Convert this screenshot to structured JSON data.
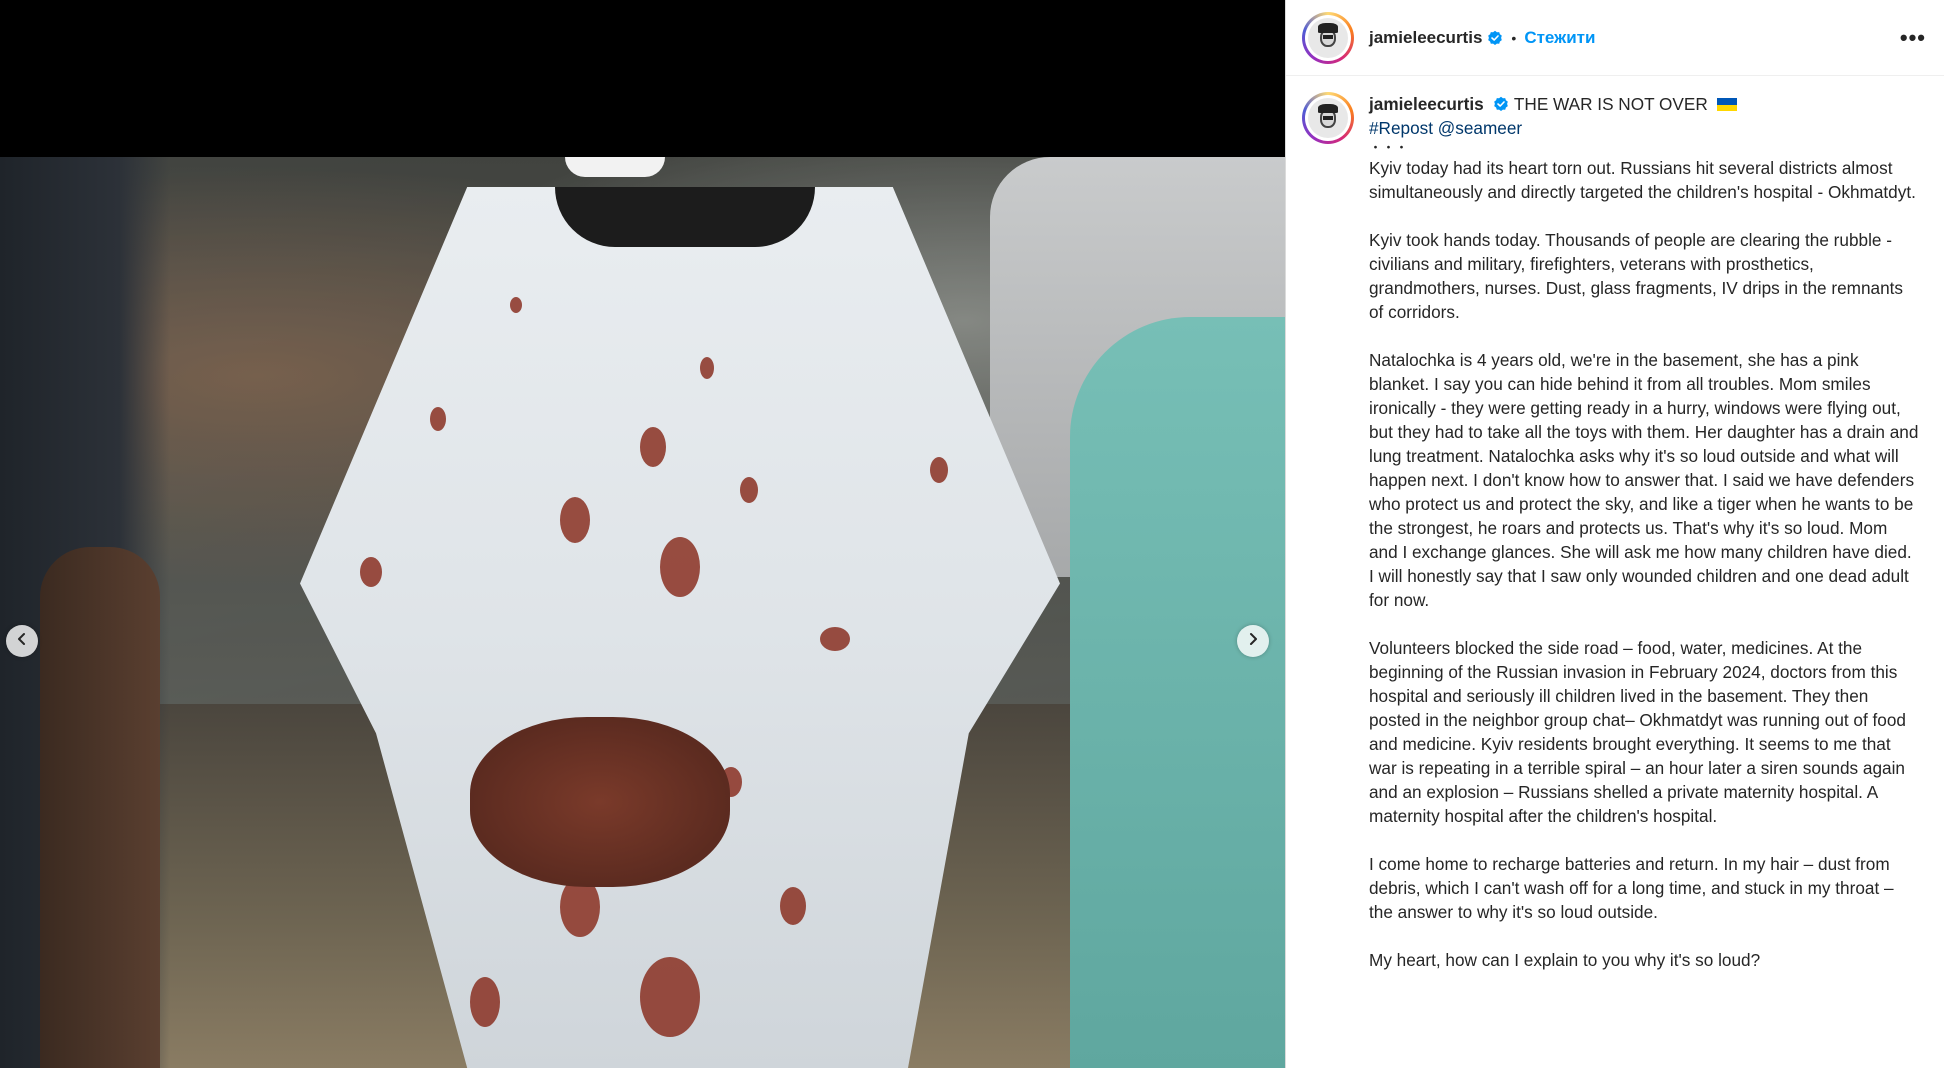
{
  "colors": {
    "accent": "#0095f6",
    "hashtag": "#00376b",
    "verified": "#0095f6"
  },
  "icons": {
    "prev": "chevron-left-icon",
    "next": "chevron-right-icon",
    "more": "more-horizontal-icon",
    "verified": "verified-badge-icon",
    "flag": "ukraine-flag-icon"
  },
  "header": {
    "username": "jamieleecurtis",
    "separator": "•",
    "follow_label": "Стежити",
    "more_label": "•••"
  },
  "caption": {
    "username": "jamieleecurtis",
    "title": "THE WAR IS NOT OVER",
    "repost": "#Repost @seameer",
    "dots": "・・・",
    "paragraphs": [
      "Kyiv today had its heart torn out. Russians hit several districts almost simultaneously and directly targeted the children's hospital - Okhmatdyt.",
      "Kyiv took hands today. Thousands of people are clearing the rubble - civilians and military, firefighters, veterans with prosthetics, grandmothers, nurses. Dust, glass fragments, IV drips in the remnants of corridors.",
      "Natalochka is 4 years old, we're in the basement, she has a pink blanket. I say you can hide behind it from all troubles. Mom smiles ironically - they were getting ready in a hurry, windows were flying out, but they had to take all the toys with them. Her daughter has a drain and lung treatment. Natalochka asks why it's so loud outside and what will happen next. I don't know how to answer that. I said we have defenders who protect us and protect the sky, and like a tiger when he wants to be the strongest, he roars and protects us. That's why it's so loud. Mom and I exchange glances. She will ask me how many children have died. I will honestly say that I saw only wounded children and one dead adult for now.",
      "Volunteers blocked the side road – food, water, medicines. At the beginning of the Russian invasion in February 2024, doctors from this hospital and seriously ill children lived in the basement. They then posted in the neighbor group chat– Okhmatdyt was running out of food and medicine. Kyiv residents brought everything. It seems to me that war is repeating in a terrible spiral – an hour later a siren sounds again and an explosion – Russians shelled a private maternity hospital. A maternity hospital after the children's hospital.",
      "I come home to recharge batteries and return. In my hair – dust from debris, which I can't wash off for a long time, and stuck in my throat – the answer to why it's so loud outside.",
      "My heart, how can I explain to you why it's so loud?"
    ]
  }
}
